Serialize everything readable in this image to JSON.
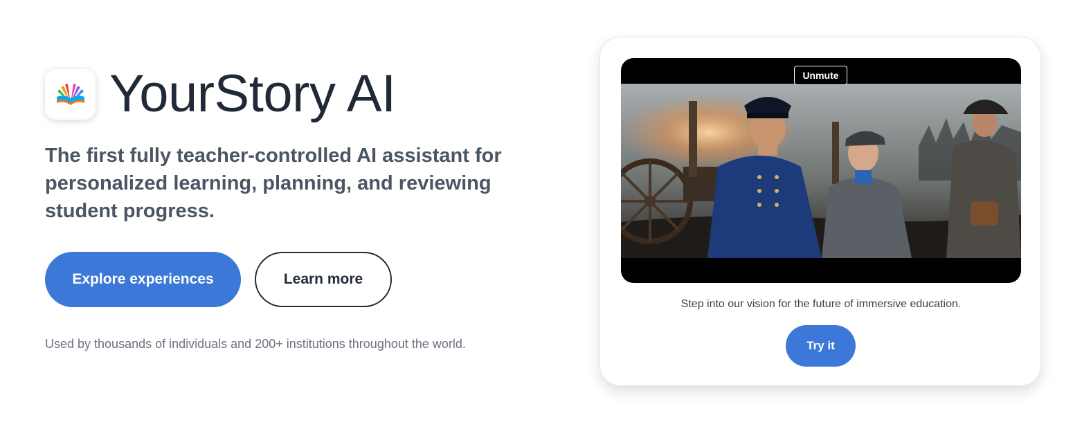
{
  "brand": {
    "logo_icon": "open-book-rainbow-icon",
    "title": "YourStory AI"
  },
  "hero": {
    "tagline": "The first fully teacher-controlled AI assistant for personalized learning, planning, and reviewing student progress.",
    "primary_button": "Explore experiences",
    "secondary_button": "Learn more",
    "usage_note": "Used by thousands of individuals and 200+ institutions throughout the world."
  },
  "preview": {
    "unmute_label": "Unmute",
    "caption": "Step into our vision for the future of immersive education.",
    "try_button": "Try it"
  },
  "colors": {
    "accent": "#3b78d8",
    "heading": "#1f2937",
    "body": "#4b5563",
    "muted": "#6b7280"
  }
}
